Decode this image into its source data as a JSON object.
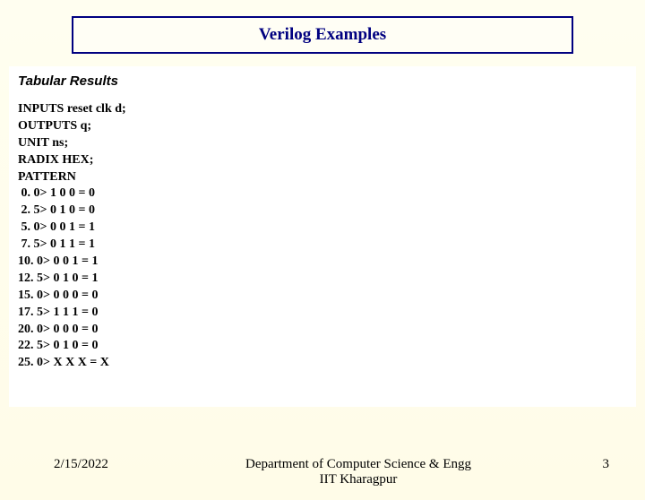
{
  "title": "Verilog Examples",
  "subtitle": "Tabular Results",
  "code_lines": [
    "INPUTS reset clk d;",
    "OUTPUTS q;",
    "UNIT ns;",
    "RADIX HEX;",
    "PATTERN",
    " 0. 0> 1 0 0 = 0",
    " 2. 5> 0 1 0 = 0",
    " 5. 0> 0 0 1 = 1",
    " 7. 5> 0 1 1 = 1",
    "10. 0> 0 0 1 = 1",
    "12. 5> 0 1 0 = 1",
    "15. 0> 0 0 0 = 0",
    "17. 5> 1 1 1 = 0",
    "20. 0> 0 0 0 = 0",
    "22. 5> 0 1 0 = 0",
    "25. 0> X X X = X"
  ],
  "footer": {
    "date": "2/15/2022",
    "dept_line1": "Department of Computer Science & Engg",
    "dept_line2": "IIT Kharagpur",
    "page": "3"
  }
}
